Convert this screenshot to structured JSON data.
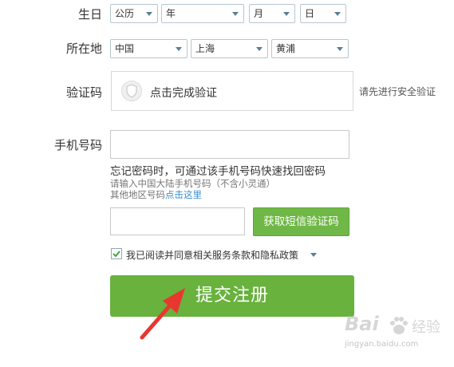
{
  "labels": {
    "birthday": "生日",
    "location": "所在地",
    "captcha": "验证码",
    "phone": "手机号码"
  },
  "birthday": {
    "calendar": "公历",
    "year": "年",
    "month": "月",
    "day": "日"
  },
  "location": {
    "country": "中国",
    "province": "上海",
    "district": "黄浦"
  },
  "captcha": {
    "button_text": "点击完成验证",
    "hint": "请先进行安全验证"
  },
  "phone": {
    "value": "",
    "tip_main": "忘记密码时，可通过该手机号码快速找回密码",
    "tip_mainland": "请输入中国大陆手机号码（不含小灵通）",
    "tip_other_prefix": "其他地区号码",
    "tip_other_link": "点击这里"
  },
  "sms": {
    "code_value": "",
    "button_label": "获取短信验证码"
  },
  "agreement": {
    "checked": true,
    "text": "我已阅读并同意相关服务条款和隐私政策"
  },
  "submit": {
    "label": "提交注册"
  },
  "watermark": {
    "brand": "Bai",
    "brand_cn": "经验",
    "url": "jingyan.baidu.com"
  },
  "colors": {
    "accent_green": "#68b23d",
    "link_blue": "#3a8fd0",
    "annotation_red": "#e8372f"
  }
}
